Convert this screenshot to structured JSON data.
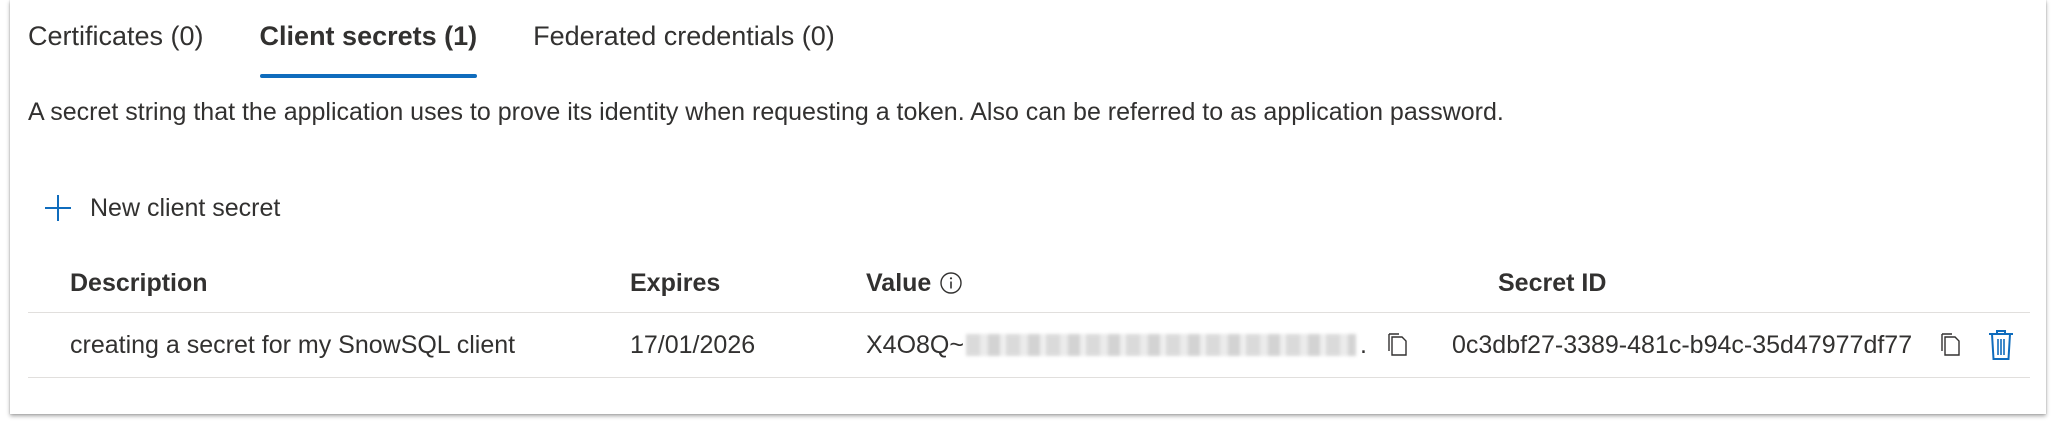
{
  "tabs": [
    {
      "label": "Certificates (0)",
      "active": false
    },
    {
      "label": "Client secrets (1)",
      "active": true
    },
    {
      "label": "Federated credentials (0)",
      "active": false
    }
  ],
  "description": "A secret string that the application uses to prove its identity when requesting a token. Also can be referred to as application password.",
  "toolbar": {
    "new_secret_label": "New client secret",
    "icon": "plus-icon"
  },
  "table": {
    "headers": {
      "description": "Description",
      "expires": "Expires",
      "value": "Value",
      "secret_id": "Secret ID"
    },
    "rows": [
      {
        "description": "creating a secret for my SnowSQL client",
        "expires": "17/01/2026",
        "value_prefix": "X4O8Q~",
        "value_suffix": ".",
        "secret_id": "0c3dbf27-3389-481c-b94c-35d47977df77"
      }
    ]
  },
  "colors": {
    "accent": "#0f6cbd",
    "text": "#323130",
    "border": "#e1dfdd"
  }
}
